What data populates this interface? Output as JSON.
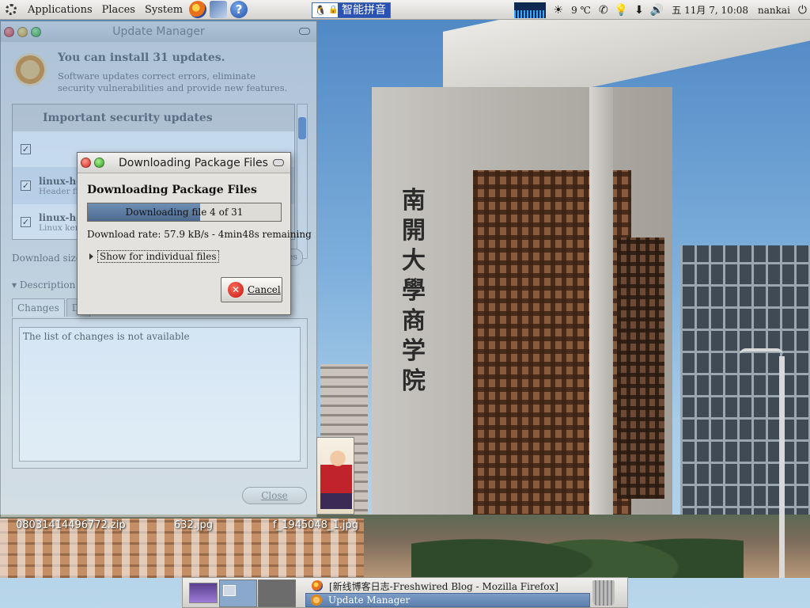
{
  "top_panel": {
    "menus": [
      "Applications",
      "Places",
      "System"
    ],
    "ime": {
      "name": "智能拼音"
    },
    "tray": {
      "weather": "9 ℃",
      "datetime": "五 11月  7, 10:08",
      "user": "nankai"
    }
  },
  "desktop": {
    "building_calligraphy": "南開大學商学院",
    "icons": [
      {
        "label": "080314144967​72.zip"
      },
      {
        "label": "632.jpg"
      },
      {
        "label": "f_1945048_1.jpg"
      }
    ]
  },
  "update_manager": {
    "title": "Update Manager",
    "heading": "You can install 31 updates.",
    "subtext": "Software updates correct errors, eliminate security vulnerabilities and provide new features.",
    "group_label": "Important security updates",
    "rows": [
      {
        "name": "linux-he",
        "desc": "Header fil"
      },
      {
        "name": "linux-he",
        "desc": "Linux ker"
      }
    ],
    "download_size_label": "Download size:",
    "check_button": "es",
    "description_label": "Description o",
    "tabs": [
      "Changes",
      "De"
    ],
    "changes_text": "The list of changes is not available",
    "close_button": "Close"
  },
  "download_dialog": {
    "title": "Downloading Package Files",
    "heading": "Downloading Package Files",
    "progress_text": "Downloading file 4 of 31",
    "progress_fraction": 0.58,
    "rate_text": "Download rate: 57.9 kB/s - 4min48s remaining",
    "expander_label": "Show for individual files",
    "cancel_button": "Cancel"
  },
  "taskbar": {
    "tasks": [
      {
        "label": "[新线博客日志-Freshwired Blog - Mozilla Firefox]",
        "active": false
      },
      {
        "label": "Update Manager",
        "active": true
      }
    ]
  }
}
